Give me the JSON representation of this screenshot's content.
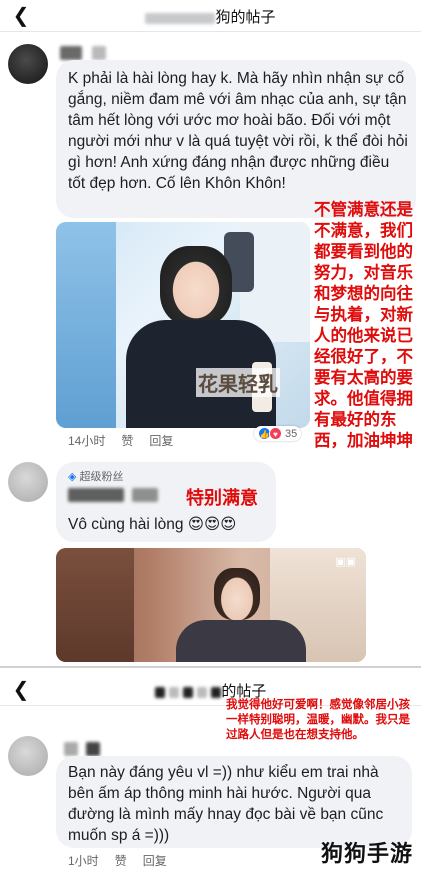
{
  "header1": {
    "title_suffix": "狗的帖子"
  },
  "header2": {
    "title_suffix": "的帖子"
  },
  "comment1": {
    "text": "K phải là hài lòng hay k. Mà hãy nhìn nhận sự cố gắng, niềm đam mê với âm nhạc của anh, sự tận tâm hết lòng với ước mơ hoài bão. Đối với một người mới như v là quá tuyệt vời rồi, k thể đòi hỏi gì hơn! Anh xứng đáng nhận được những điều tốt đẹp hơn. Cố lên Khôn Khôn!",
    "time": "14小时",
    "like": "赞",
    "reply": "回复",
    "reaction_count": "35",
    "photo_caption": "花果轻乳"
  },
  "annotation1": {
    "text": "不管满意还是不满意，我们都要看到他的努力，对音乐和梦想的向往与执着，对新人的他来说已经很好了，不要有太高的要求。他值得拥有最好的东西，加油坤坤"
  },
  "comment2": {
    "badge": "超级粉丝",
    "annotation": "特别满意",
    "text": "Vô cùng hài lòng 😍😍😍"
  },
  "annotation2": {
    "text": "我觉得他好可爱啊！感觉像邻居小孩一样特别聪明，温暖，幽默。我只是过路人但是也在想支持他。"
  },
  "comment3": {
    "text": "Bạn này đáng yêu vl =)) như kiểu em trai nhà bên ấm áp thông minh hài hước. Người qua đường là mình mấy hnay đọc bài về bạn cũnc muốn sp á =)))",
    "time": "1小时",
    "like": "赞",
    "reply": "回复"
  },
  "watermark": {
    "text": "狗狗手游"
  },
  "colors": {
    "annotation_red": "#e00b0b",
    "bubble_bg": "#f0f2f5",
    "like_blue": "#1877f2",
    "love_red": "#f33e58"
  }
}
